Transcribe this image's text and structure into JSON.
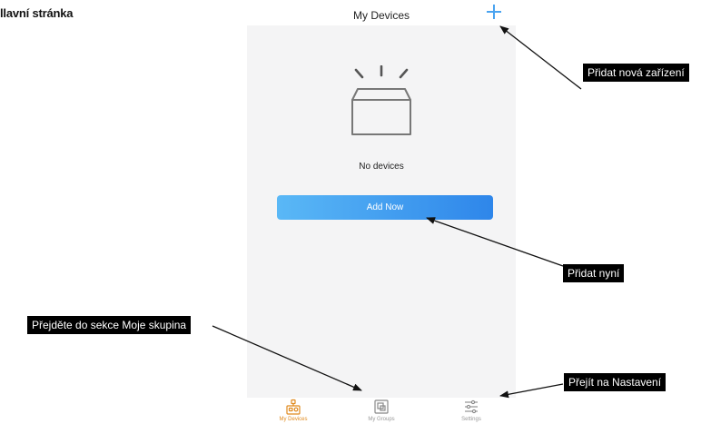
{
  "page_heading": "llavní stránka",
  "app": {
    "title": "My Devices",
    "empty_text": "No devices",
    "add_button_label": "Add Now",
    "tabs": [
      {
        "label": "My Devices",
        "icon": "devices-icon",
        "active": true
      },
      {
        "label": "My Groups",
        "icon": "groups-icon",
        "active": false
      },
      {
        "label": "Settings",
        "icon": "settings-sliders-icon",
        "active": false
      }
    ]
  },
  "callouts": {
    "add_new_devices": "Přidat nová zařízení",
    "add_now": "Přidat nyní",
    "go_to_groups": "Přejděte do sekce Moje skupina",
    "go_to_settings": "Přejít na Nastavení"
  },
  "colors": {
    "accent_blue": "#4aa3f0",
    "button_gradient_start": "#5ab8f6",
    "button_gradient_end": "#2e86ea",
    "active_tab": "#e08a1e",
    "callout_background": "#000000"
  }
}
